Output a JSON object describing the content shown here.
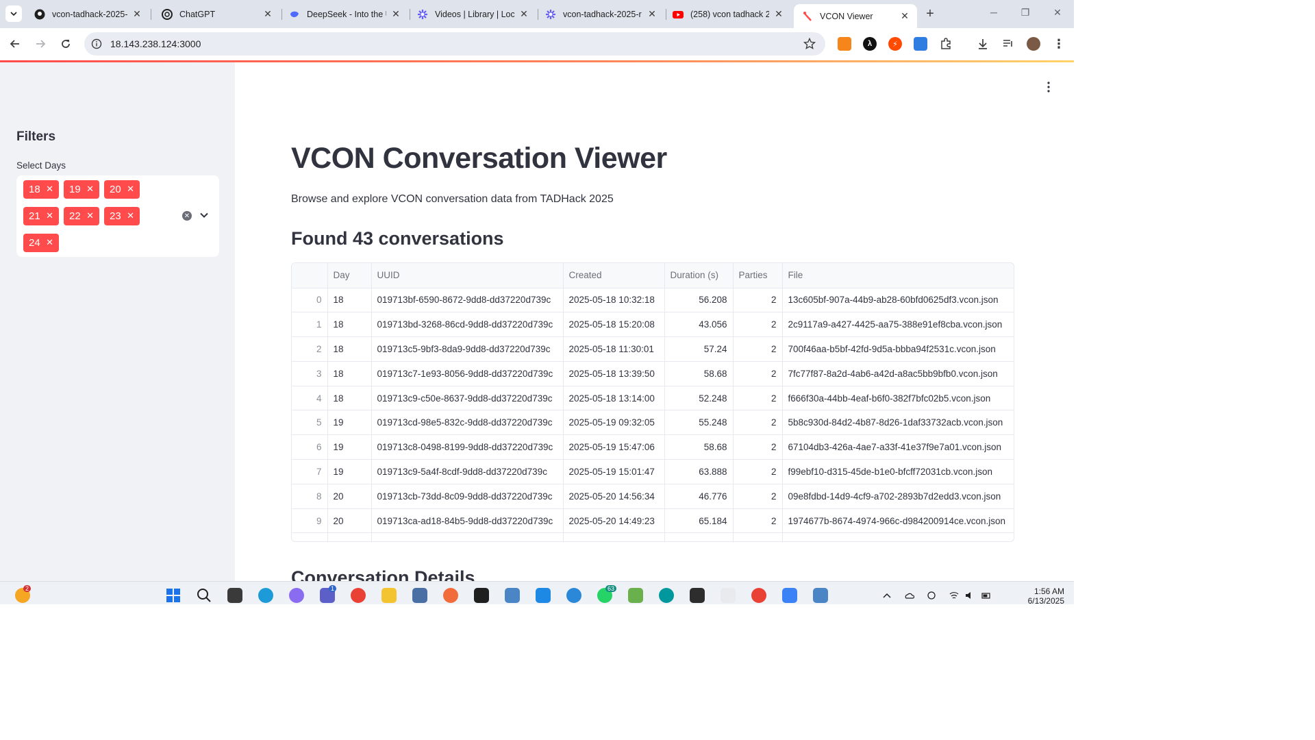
{
  "browser": {
    "tabs": [
      {
        "title": "vcon-tadhack-2025-r",
        "icon": "github-icon"
      },
      {
        "title": "ChatGPT",
        "icon": "chatgpt-icon"
      },
      {
        "title": "DeepSeek - Into the U",
        "icon": "deepseek-icon"
      },
      {
        "title": "Videos | Library | Loc",
        "icon": "loom-icon"
      },
      {
        "title": "vcon-tadhack-2025-r",
        "icon": "loom-icon"
      },
      {
        "title": "(258) vcon tadhack 2",
        "icon": "youtube-icon"
      },
      {
        "title": "VCON Viewer",
        "icon": "streamlit-icon",
        "active": true
      }
    ],
    "url": "18.143.238.124:3000"
  },
  "sidebar": {
    "title": "Filters",
    "select_label": "Select Days",
    "selected_days": [
      "18",
      "19",
      "20",
      "21",
      "22",
      "23",
      "24"
    ]
  },
  "main": {
    "title": "VCON Conversation Viewer",
    "caption": "Browse and explore VCON conversation data from TADHack 2025",
    "found_heading": "Found 43 conversations",
    "details_heading": "Conversation Details"
  },
  "table": {
    "columns": [
      "",
      "Day",
      "UUID",
      "Created",
      "Duration (s)",
      "Parties",
      "File"
    ],
    "rows": [
      [
        "0",
        "18",
        "019713bf-6590-8672-9dd8-dd37220d739c",
        "2025-05-18 10:32:18",
        "56.208",
        "2",
        "13c605bf-907a-44b9-ab28-60bfd0625df3.vcon.json"
      ],
      [
        "1",
        "18",
        "019713bd-3268-86cd-9dd8-dd37220d739c",
        "2025-05-18 15:20:08",
        "43.056",
        "2",
        "2c9117a9-a427-4425-aa75-388e91ef8cba.vcon.json"
      ],
      [
        "2",
        "18",
        "019713c5-9bf3-8da9-9dd8-dd37220d739c",
        "2025-05-18 11:30:01",
        "57.24",
        "2",
        "700f46aa-b5bf-42fd-9d5a-bbba94f2531c.vcon.json"
      ],
      [
        "3",
        "18",
        "019713c7-1e93-8056-9dd8-dd37220d739c",
        "2025-05-18 13:39:50",
        "58.68",
        "2",
        "7fc77f87-8a2d-4ab6-a42d-a8ac5bb9bfb0.vcon.json"
      ],
      [
        "4",
        "18",
        "019713c9-c50e-8637-9dd8-dd37220d739c",
        "2025-05-18 13:14:00",
        "52.248",
        "2",
        "f666f30a-44bb-4eaf-b6f0-382f7bfc02b5.vcon.json"
      ],
      [
        "5",
        "19",
        "019713cd-98e5-832c-9dd8-dd37220d739c",
        "2025-05-19 09:32:05",
        "55.248",
        "2",
        "5b8c930d-84d2-4b87-8d26-1daf33732acb.vcon.json"
      ],
      [
        "6",
        "19",
        "019713c8-0498-8199-9dd8-dd37220d739c",
        "2025-05-19 15:47:06",
        "58.68",
        "2",
        "67104db3-426a-4ae7-a33f-41e37f9e7a01.vcon.json"
      ],
      [
        "7",
        "19",
        "019713c9-5a4f-8cdf-9dd8-dd37220d739c",
        "2025-05-19 15:01:47",
        "63.888",
        "2",
        "f99ebf10-d315-45de-b1e0-bfcff72031cb.vcon.json"
      ],
      [
        "8",
        "20",
        "019713cb-73dd-8c09-9dd8-dd37220d739c",
        "2025-05-20 14:56:34",
        "46.776",
        "2",
        "09e8fdbd-14d9-4cf9-a702-2893b7d2edd3.vcon.json"
      ],
      [
        "9",
        "20",
        "019713ca-ad18-84b5-9dd8-dd37220d739c",
        "2025-05-20 14:49:23",
        "65.184",
        "2",
        "1974677b-8674-4974-966c-d984200914ce.vcon.json"
      ]
    ]
  },
  "taskbar": {
    "weather_badge": "2",
    "teams_badge": "1",
    "whatsapp_badge": "63",
    "time": "1:56 AM",
    "date": "6/13/2025"
  },
  "colors": {
    "accent": "#ff4b4b",
    "sidebar_bg": "#f0f2f6",
    "text": "#31333f"
  }
}
